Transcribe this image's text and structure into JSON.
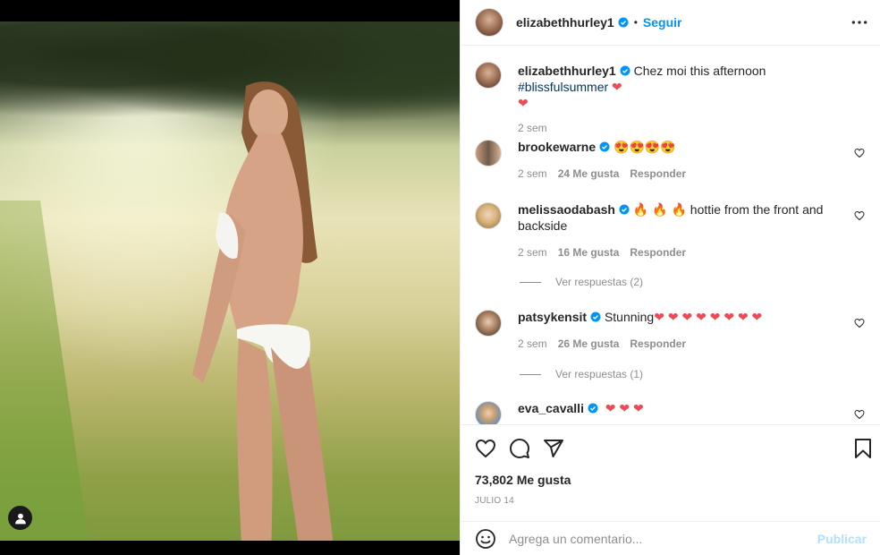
{
  "post": {
    "author": "elizabethhurley1",
    "follow_label": "Seguir",
    "dot": "•",
    "caption_text": "Chez moi this afternoon",
    "caption_hashtag": "#blissfulsummer",
    "caption_age": "2 sem",
    "likes": "73,802 Me gusta",
    "date": "JULIO 14"
  },
  "comments": [
    {
      "user": "brookewarne",
      "text": "😍😍😍😍",
      "age": "2 sem",
      "likes": "24 Me gusta",
      "reply": "Responder"
    },
    {
      "user": "melissaodabash",
      "text": "🔥 🔥 🔥  hottie from the front and backside",
      "age": "2 sem",
      "likes": "16 Me gusta",
      "reply": "Responder",
      "view_replies": "Ver respuestas (2)"
    },
    {
      "user": "patsykensit",
      "text": "Stunning",
      "age": "2 sem",
      "likes": "26 Me gusta",
      "reply": "Responder",
      "view_replies": "Ver respuestas (1)"
    },
    {
      "user": "eva_cavalli",
      "text": ""
    }
  ],
  "comment_box": {
    "placeholder": "Agrega un comentario...",
    "post_label": "Publicar"
  },
  "icons": {
    "more": "more-options-icon",
    "like": "heart-icon",
    "comment": "comment-icon",
    "share": "share-icon",
    "save": "bookmark-icon",
    "emoji": "emoji-icon",
    "tag": "user-tag-icon",
    "verified": "verified-badge-icon"
  },
  "colors": {
    "accent": "#0095f6",
    "heart": "#ed4956",
    "muted": "#8e8e8e",
    "publish_disabled": "#b2dffc"
  }
}
